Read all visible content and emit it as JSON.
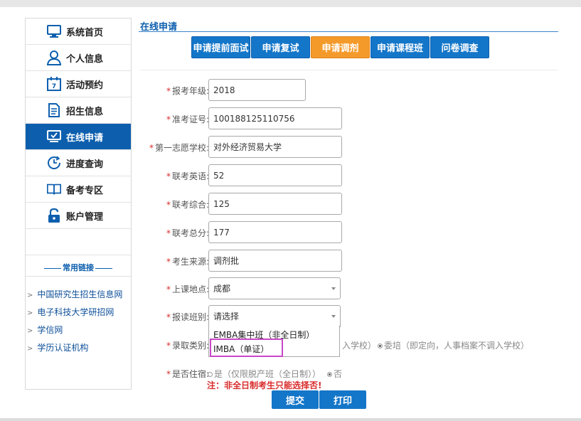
{
  "sidebar": {
    "items": [
      {
        "label": "系统首页",
        "icon": "monitor-icon"
      },
      {
        "label": "个人信息",
        "icon": "user-icon"
      },
      {
        "label": "活动预约",
        "icon": "calendar-icon"
      },
      {
        "label": "招生信息",
        "icon": "document-icon"
      },
      {
        "label": "在线申请",
        "icon": "apply-screen-icon"
      },
      {
        "label": "进度查询",
        "icon": "progress-clock-icon"
      },
      {
        "label": "备考专区",
        "icon": "book-icon"
      },
      {
        "label": "账户管理",
        "icon": "lock-icon"
      }
    ],
    "active_index": 4,
    "links_title": "常用链接",
    "links": [
      "中国研究生招生信息网",
      "电子科技大学研招网",
      "学信网",
      "学历认证机构"
    ]
  },
  "main": {
    "section_title": "在线申请",
    "tabs": [
      "申请提前面试",
      "申请复试",
      "申请调剂",
      "申请课程班",
      "问卷调查"
    ],
    "active_tab_index": 2,
    "fields": {
      "year": {
        "label": "报考年级:",
        "value": "2018"
      },
      "exam_no": {
        "label": "准考证号:",
        "value": "100188125110756"
      },
      "first_choice": {
        "label": "第一志愿学校:",
        "value": "对外经济贸易大学"
      },
      "english": {
        "label": "联考英语:",
        "value": "52"
      },
      "comprehensive": {
        "label": "联考综合:",
        "value": "125"
      },
      "total": {
        "label": "联考总分:",
        "value": "177"
      },
      "source": {
        "label": "考生来源:",
        "value": "调剂批"
      },
      "location": {
        "label": "上课地点:",
        "value": "成都"
      },
      "class_type": {
        "label": "报读班别:",
        "value": "请选择",
        "options": [
          "EMBA集中班（非全日制）",
          "IMBA（单证）"
        ]
      },
      "admission_type": {
        "label": "录取类别:",
        "option_a_tail": "入学校）",
        "option_b": "委培（即定向，人事档案不调入学校）"
      },
      "boarding": {
        "label": "是否住宿:",
        "option_yes": "是（仅限脱产班（全日制））",
        "option_no": "否"
      }
    },
    "note": "注：非全日制考生只能选择否!",
    "buttons": {
      "submit": "提交",
      "print": "打印"
    }
  },
  "colors": {
    "primary": "#0d5fae",
    "accent": "#f49a2a",
    "required": "#d92b2b",
    "highlight": "#c848c8"
  }
}
